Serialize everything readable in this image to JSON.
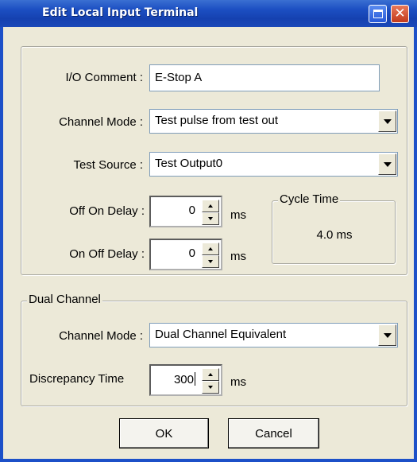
{
  "window": {
    "title": "Edit Local Input Terminal"
  },
  "io_comment": {
    "label": "I/O Comment :",
    "value": "E-Stop A"
  },
  "channel_mode": {
    "label": "Channel Mode :",
    "value": "Test pulse from test out"
  },
  "test_source": {
    "label": "Test Source :",
    "value": "Test Output0"
  },
  "off_on_delay": {
    "label": "Off On Delay :",
    "value": "0",
    "unit": "ms"
  },
  "on_off_delay": {
    "label": "On Off Delay :",
    "value": "0",
    "unit": "ms"
  },
  "cycle_time": {
    "caption": "Cycle Time",
    "value": "4.0 ms"
  },
  "dual_channel": {
    "caption": "Dual Channel",
    "channel_mode_label": "Channel Mode :",
    "channel_mode_value": "Dual Channel Equivalent",
    "discrepancy_label": "Discrepancy Time",
    "discrepancy_value": "300",
    "discrepancy_unit": "ms"
  },
  "buttons": {
    "ok": "OK",
    "cancel": "Cancel"
  },
  "colors": {
    "title_bar": "#1c4fc2",
    "dialog_bg": "#ece9d8",
    "close_button": "#c2391c"
  }
}
